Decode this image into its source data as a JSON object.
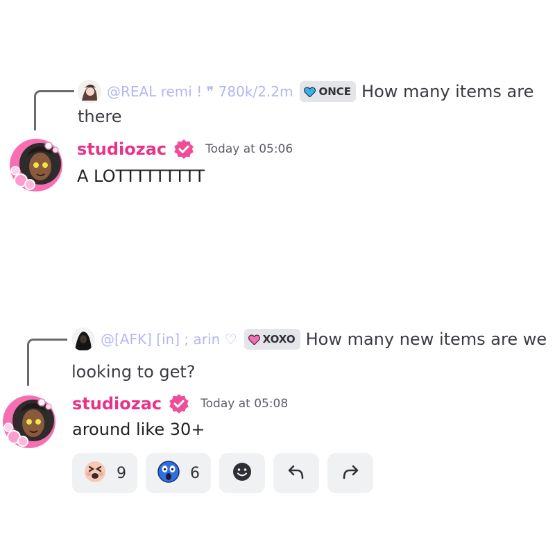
{
  "messages": [
    {
      "reply": {
        "username": "@REAL remi ! ❞ 780k/2.2m",
        "tag": "ONCE",
        "tag_heart_color": "#3ab0e8",
        "text_line1": "How many items are",
        "text_line2": "there"
      },
      "author": "studiozac",
      "timestamp": "Today at 05:06",
      "content": "A LOTTTTTTTTT"
    },
    {
      "reply": {
        "username": "@[AFK] [in] ; arin ♡",
        "tag": "XOXO",
        "tag_heart_color": "#e83f97",
        "text_line1": "How many new items are we",
        "text_line2": "looking to get?"
      },
      "author": "studiozac",
      "timestamp": "Today at 05:08",
      "content": "around like 30+",
      "reactions": [
        {
          "emoji": "tired-face-emoji",
          "count": "9"
        },
        {
          "emoji": "screaming-face-emoji",
          "count": "6"
        }
      ],
      "actions": [
        {
          "icon": "add-reaction-icon"
        },
        {
          "icon": "reply-icon"
        },
        {
          "icon": "forward-icon"
        }
      ]
    }
  ],
  "colors": {
    "username": "#e8338a",
    "reply_username": "#b3b6f2",
    "pill_bg": "#f0f1f3"
  }
}
